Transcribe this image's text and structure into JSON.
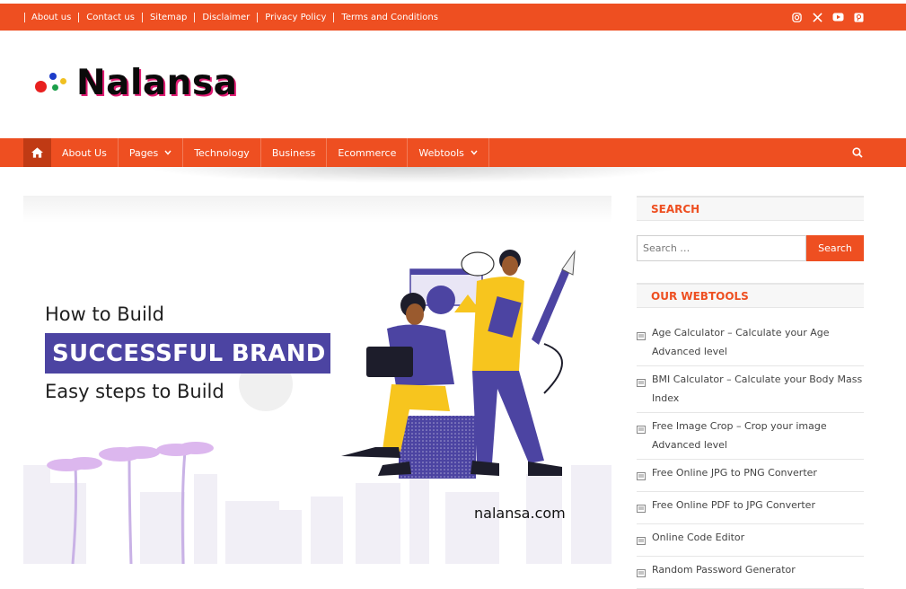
{
  "topbar": {
    "links": [
      "About us",
      "Contact us",
      "Sitemap",
      "Disclaimer",
      "Privacy Policy",
      "Terms and Conditions"
    ],
    "social_icons": [
      "instagram-icon",
      "x-twitter-icon",
      "youtube-icon",
      "pinterest-icon"
    ]
  },
  "brand": {
    "name": "Nalansa"
  },
  "nav": {
    "items": [
      {
        "label": "About Us",
        "dropdown": false
      },
      {
        "label": "Pages",
        "dropdown": true
      },
      {
        "label": "Technology",
        "dropdown": false
      },
      {
        "label": "Business",
        "dropdown": false
      },
      {
        "label": "Ecommerce",
        "dropdown": false
      },
      {
        "label": "Webtools",
        "dropdown": true
      }
    ],
    "home_icon": "home-icon",
    "search_icon": "search-icon"
  },
  "hero": {
    "line1": "How to Build",
    "band": "SUCCESSFUL BRAND",
    "line2": "Easy steps to Build",
    "site": "nalansa.com"
  },
  "sidebar": {
    "search_title": "SEARCH",
    "search_placeholder": "Search …",
    "search_button": "Search",
    "tools_title": "OUR WEBTOOLS",
    "tools": [
      "Age Calculator – Calculate your Age Advanced level",
      "BMI Calculator – Calculate your Body Mass Index",
      "Free Image Crop – Crop your image Advanced level",
      "Free Online JPG to PNG Converter",
      "Free Online PDF to JPG Converter",
      "Online Code Editor",
      "Random Password Generator"
    ]
  },
  "colors": {
    "accent": "#ee4f21",
    "accent_dark": "#c03a14",
    "band": "#4c44a2"
  }
}
